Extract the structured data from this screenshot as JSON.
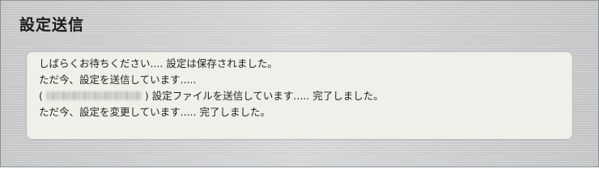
{
  "window": {
    "title": "設定送信"
  },
  "status": {
    "line1": "しばらくお待ちください.... 設定は保存されました。",
    "line2": "ただ今、設定を送信しています.....",
    "line3_open": "(",
    "line3_rest": ") 設定ファイルを送信しています..... 完了しました。",
    "line4": "ただ今、設定を変更しています..... 完了しました。"
  }
}
